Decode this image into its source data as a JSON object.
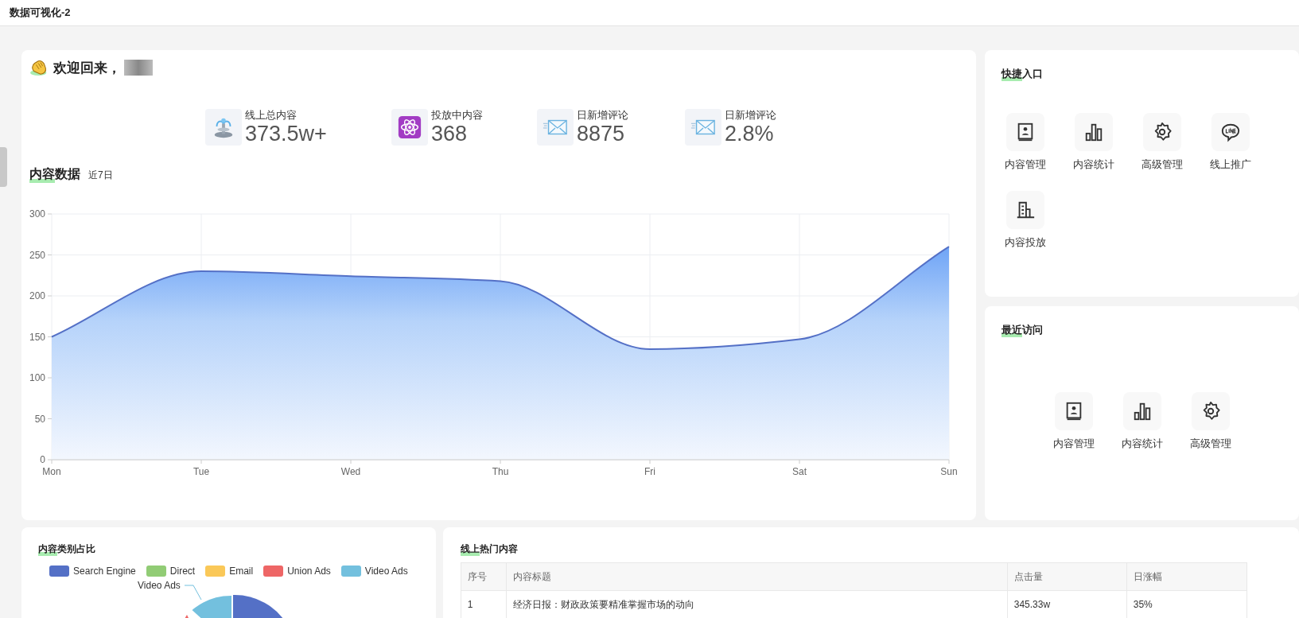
{
  "header": {
    "title": "数据可视化-2"
  },
  "welcome": {
    "greeting": "欢迎回来，"
  },
  "stats": [
    {
      "kind": "fountain",
      "label": "线上总内容",
      "value": "373.5w+"
    },
    {
      "kind": "atom",
      "label": "投放中内容",
      "value": "368"
    },
    {
      "kind": "envelope",
      "label": "日新增评论",
      "value": "8875"
    },
    {
      "kind": "envelope",
      "label": "日新增评论",
      "value": "2.8%"
    }
  ],
  "content_data": {
    "title": "内容数据",
    "subtitle": "近7日",
    "chart_data": {
      "type": "area",
      "categories": [
        "Mon",
        "Tue",
        "Wed",
        "Thu",
        "Fri",
        "Sat",
        "Sun"
      ],
      "series": [
        {
          "color": "#5470c6",
          "values": [
            150,
            230,
            224,
            218,
            135,
            147,
            260
          ]
        }
      ],
      "ylim": [
        0,
        300
      ],
      "yticks": [
        0,
        50,
        100,
        150,
        200,
        250,
        300
      ],
      "grid": true
    }
  },
  "quick_entry": {
    "title": "快捷入口",
    "items": [
      {
        "kind": "contact-book",
        "label": "内容管理"
      },
      {
        "kind": "bar-chart",
        "label": "内容统计"
      },
      {
        "kind": "gear",
        "label": "高级管理"
      },
      {
        "kind": "line-bubble",
        "label": "线上推广"
      },
      {
        "kind": "building",
        "label": "内容投放"
      }
    ]
  },
  "recent_visits": {
    "title": "最近访问",
    "items": [
      {
        "kind": "contact-book",
        "label": "内容管理"
      },
      {
        "kind": "bar-chart",
        "label": "内容统计"
      },
      {
        "kind": "gear",
        "label": "高级管理"
      }
    ]
  },
  "category_share": {
    "title": "内容类别占比",
    "legend": [
      {
        "label": "Search Engine",
        "color": "#5470c6"
      },
      {
        "label": "Direct",
        "color": "#91cc75"
      },
      {
        "label": "Email",
        "color": "#fac858"
      },
      {
        "label": "Union Ads",
        "color": "#ee6666"
      },
      {
        "label": "Video Ads",
        "color": "#73c0de"
      }
    ],
    "slice_label": "Video Ads"
  },
  "hot_content": {
    "title": "线上热门内容",
    "columns": [
      "序号",
      "内容标题",
      "点击量",
      "日涨幅"
    ],
    "rows": [
      [
        "1",
        "经济日报：财政政策要精准掌握市场的动向",
        "345.33w",
        "35%"
      ]
    ]
  }
}
